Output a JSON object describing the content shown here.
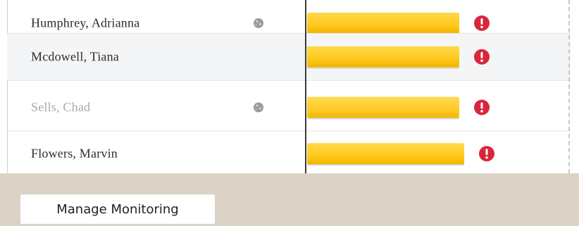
{
  "rows": [
    {
      "name": "Humphrey, Adrianna",
      "globe": true,
      "inactive": false,
      "progress": 0.93,
      "alert": true
    },
    {
      "name": "Mcdowell, Tiana",
      "globe": false,
      "inactive": false,
      "progress": 0.93,
      "alert": true
    },
    {
      "name": "Sells, Chad",
      "globe": true,
      "inactive": true,
      "progress": 0.93,
      "alert": true
    },
    {
      "name": "Flowers, Marvin",
      "globe": false,
      "inactive": false,
      "progress": 0.96,
      "alert": true
    }
  ],
  "icons": {
    "globe": "globe-icon",
    "alert": "alert-icon"
  },
  "colors": {
    "bar": "#ffcb1f",
    "alert": "#d9263c",
    "globe": "#9a9a9a",
    "footer": "#dcd3c7"
  },
  "footer": {
    "manage_label": "Manage Monitoring"
  }
}
